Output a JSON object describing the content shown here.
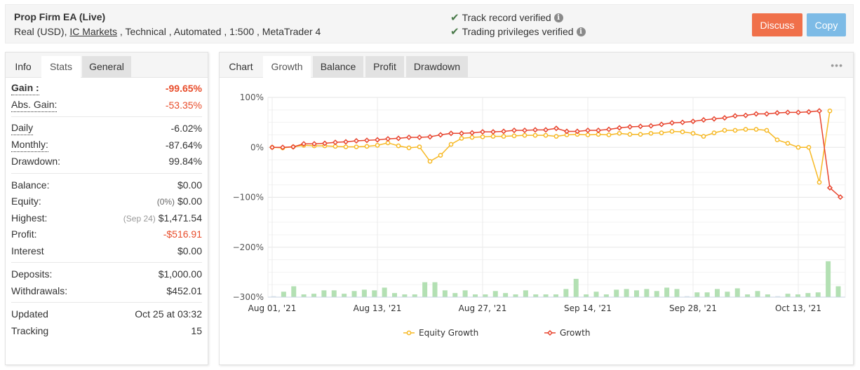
{
  "header": {
    "title": "Prop Firm EA (Live)",
    "sub_prefix": "Real (USD), ",
    "broker_link": "IC Markets",
    "sub_suffix": " , Technical , Automated , 1:500 , MetaTrader 4",
    "verifications": [
      {
        "icon": "check-icon",
        "label": "Track record verified"
      },
      {
        "icon": "check-icon",
        "label": "Trading privileges verified"
      }
    ],
    "discuss_label": "Discuss",
    "copy_label": "Copy",
    "colors": {
      "discuss": "#f0704a",
      "copy": "#7dbbe6"
    }
  },
  "left_tabs": [
    "Info",
    "Stats",
    "General"
  ],
  "stats": {
    "gain": {
      "label": "Gain :",
      "value": "-99.65%"
    },
    "abs_gain": {
      "label": "Abs. Gain:",
      "value": "-53.35%"
    },
    "daily": {
      "label": "Daily",
      "value": "-6.02%"
    },
    "monthly": {
      "label": "Monthly:",
      "value": "-87.64%"
    },
    "drawdown": {
      "label": "Drawdown:",
      "value": "99.84%"
    },
    "balance": {
      "label": "Balance:",
      "value": "$0.00"
    },
    "equity": {
      "label": "Equity:",
      "note": "(0%)",
      "value": "$0.00"
    },
    "highest": {
      "label": "Highest:",
      "note": "(Sep 24)",
      "value": "$1,471.54"
    },
    "profit": {
      "label": "Profit:",
      "value": "-$516.91"
    },
    "interest": {
      "label": "Interest",
      "value": "$0.00"
    },
    "deposits": {
      "label": "Deposits:",
      "value": "$1,000.00"
    },
    "withdrawals": {
      "label": "Withdrawals:",
      "value": "$452.01"
    },
    "updated": {
      "label": "Updated",
      "value": "Oct 25 at 03:32"
    },
    "tracking": {
      "label": "Tracking",
      "value": "15"
    },
    "negative_color": "#e84c2a"
  },
  "chart_tabs": [
    "Chart",
    "Growth",
    "Balance",
    "Profit",
    "Drawdown"
  ],
  "chart_more": "•••",
  "chart_data": {
    "type": "line",
    "title": "",
    "xlabel": "",
    "ylabel": "",
    "ylim": [
      -300,
      100
    ],
    "yticks": [
      100,
      0,
      -100,
      -200,
      -300
    ],
    "ytick_labels": [
      "100%",
      "0%",
      "−100%",
      "−200%",
      "−300%"
    ],
    "xtick_labels": [
      {
        "index": 0,
        "label": "Aug 01, '21"
      },
      {
        "index": 10,
        "label": "Aug 13, '21"
      },
      {
        "index": 20,
        "label": "Aug 27, '21"
      },
      {
        "index": 30,
        "label": "Sep 14, '21"
      },
      {
        "index": 40,
        "label": "Sep 28, '21"
      },
      {
        "index": 50,
        "label": "Oct 13, '21"
      }
    ],
    "grid": true,
    "legend": "bottom-center",
    "series": [
      {
        "name": "Equity Growth",
        "color": "#f7b924",
        "values": [
          0,
          -1,
          1,
          4,
          3,
          3,
          2,
          1,
          1,
          2,
          4,
          9,
          3,
          -1,
          1,
          -28,
          -16,
          6,
          18,
          20,
          21,
          22,
          22,
          23,
          24,
          24,
          24,
          22,
          25,
          26,
          25,
          26,
          25,
          28,
          26,
          26,
          28,
          29,
          32,
          31,
          28,
          22,
          29,
          34,
          34,
          36,
          36,
          34,
          15,
          8,
          0,
          0,
          -70,
          73
        ]
      },
      {
        "name": "Growth",
        "color": "#e8452f",
        "values": [
          0,
          0,
          1,
          7,
          7,
          8,
          10,
          11,
          13,
          14,
          15,
          17,
          18,
          20,
          20,
          21,
          25,
          28,
          28,
          29,
          31,
          31,
          32,
          34,
          34,
          35,
          35,
          38,
          32,
          32,
          34,
          34,
          36,
          39,
          41,
          42,
          43,
          46,
          49,
          50,
          52,
          55,
          57,
          59,
          63,
          64,
          67,
          67,
          69,
          70,
          70,
          71,
          73,
          -81,
          -99.65
        ]
      }
    ],
    "bars": {
      "name": "Daily activity",
      "color": "#b3e0b3",
      "values": [
        1,
        8,
        16,
        4,
        5,
        10,
        10,
        5,
        9,
        11,
        10,
        14,
        6,
        4,
        4,
        22,
        22,
        10,
        6,
        10,
        4,
        4,
        9,
        6,
        4,
        10,
        4,
        4,
        4,
        12,
        27,
        4,
        8,
        4,
        11,
        12,
        10,
        12,
        9,
        14,
        12,
        1,
        7,
        7,
        12,
        8,
        13,
        4,
        9,
        4,
        1,
        5,
        4,
        6,
        7,
        53,
        16
      ]
    }
  }
}
